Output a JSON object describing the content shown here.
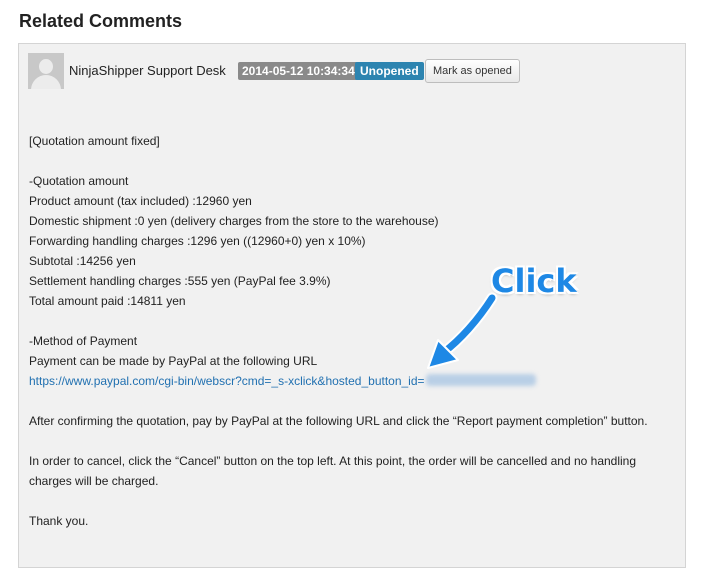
{
  "section": {
    "title": "Related Comments"
  },
  "comment": {
    "author": "NinjaShipper Support Desk",
    "date": "2014-05-12 10:34:34",
    "status": "Unopened",
    "mark_button": "Mark as opened",
    "lines": {
      "l1": "[Quotation amount fixed]",
      "l2": "-Quotation amount",
      "l3": "Product amount (tax included) :12960 yen",
      "l4": "Domestic shipment :0 yen (delivery charges from the store to the warehouse)",
      "l5": "Forwarding handling charges :1296 yen ((12960+0) yen x 10%)",
      "l6": "Subtotal :14256 yen",
      "l7": "Settlement handling charges :555 yen (PayPal fee 3.9%)",
      "l8": "Total amount paid :14811 yen",
      "l9": "-Method of Payment",
      "l10": "Payment can be made by PayPal at the following URL",
      "link": "https://www.paypal.com/cgi-bin/webscr?cmd=_s-xclick&hosted_button_id=",
      "l11": "After confirming the quotation, pay by PayPal at the following URL and click the “Report payment completion” button.",
      "l12": "In order to cancel, click the “Cancel” button on the top left. At this point, the order will be cancelled and no handling charges will be charged.",
      "l13": "Thank you."
    }
  },
  "annotation": {
    "label": "Click",
    "color": "#1e88e5"
  },
  "colors": {
    "status_badge": "#2d84b0",
    "date_badge": "#8a8a8a",
    "link": "#2271b1"
  }
}
